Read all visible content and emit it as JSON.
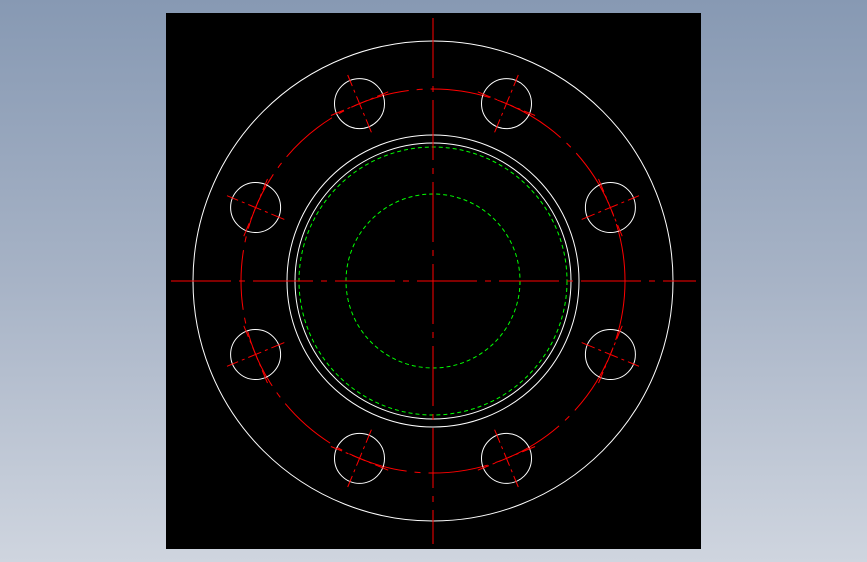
{
  "drawing": {
    "type": "flange-top-view",
    "bolt_hole_count": 8,
    "colors": {
      "background": "#000000",
      "outline": "#ffffff",
      "centerline": "#ff0000",
      "hidden": "#00ff00"
    }
  }
}
